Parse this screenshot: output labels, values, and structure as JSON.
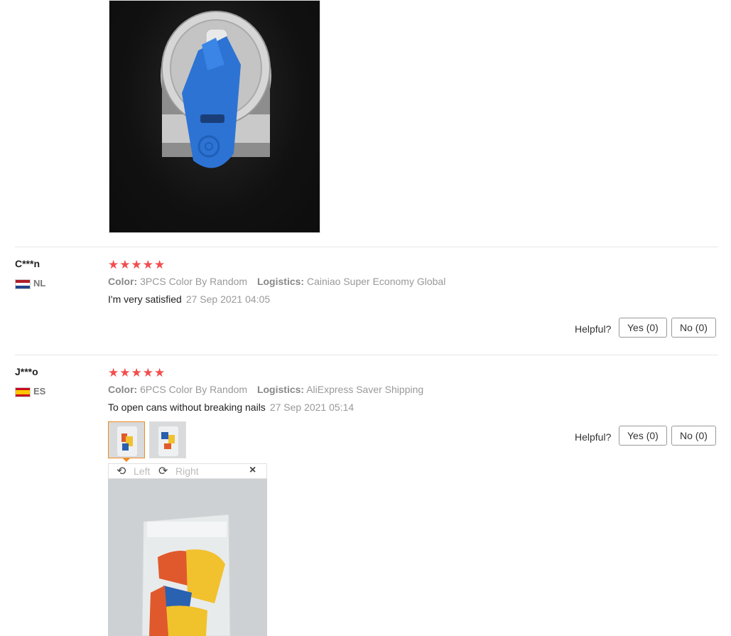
{
  "reviews": [
    {
      "user": "C***n",
      "country": "NL",
      "stars": "★★★★★",
      "color_label": "Color:",
      "color_value": "3PCS Color By Random",
      "logistics_label": "Logistics:",
      "logistics_value": "Cainiao Super Economy Global",
      "text": "I'm very satisfied",
      "date": "27 Sep 2021 04:05",
      "helpful_label": "Helpful?",
      "yes_label": "Yes (0)",
      "no_label": "No (0)"
    },
    {
      "user": "J***o",
      "country": "ES",
      "stars": "★★★★★",
      "color_label": "Color:",
      "color_value": "6PCS Color By Random",
      "logistics_label": "Logistics:",
      "logistics_value": "AliExpress Saver Shipping",
      "text": "To open cans without breaking nails",
      "date": "27 Sep 2021 05:14",
      "helpful_label": "Helpful?",
      "yes_label": "Yes (0)",
      "no_label": "No (0)"
    }
  ],
  "viewer": {
    "left_label": "Left",
    "right_label": "Right",
    "close_glyph": "×"
  },
  "colors": {
    "star": "#f24e4e",
    "thumb_active_border": "#f08a24"
  }
}
